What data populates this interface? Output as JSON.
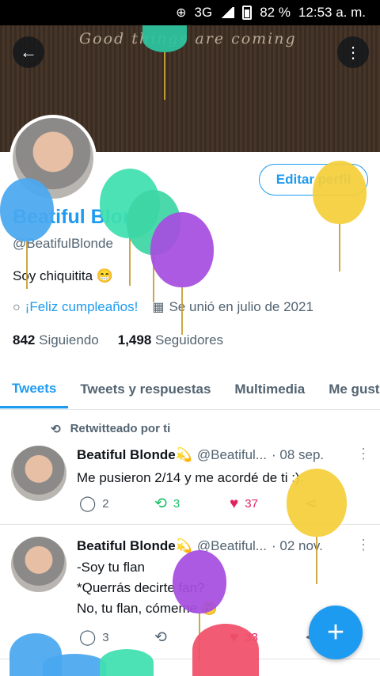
{
  "status_bar": {
    "network": "3G",
    "battery": "82 %",
    "time": "12:53 a. m."
  },
  "banner": {
    "text": "Good things are coming"
  },
  "profile": {
    "edit_label": "Editar perfil",
    "display_name": "Beatiful Blonde",
    "handle": "@BeatifulBlonde",
    "bio": "Soy chiquitita 😁",
    "birthday": "¡Feliz cumpleaños!",
    "joined": "Se unió en julio de 2021",
    "following_count": "842",
    "following_label": "Siguiendo",
    "followers_count": "1,498",
    "followers_label": "Seguidores"
  },
  "tabs": [
    "Tweets",
    "Tweets y respuestas",
    "Multimedia",
    "Me gusta"
  ],
  "retweet_label": "Retwitteado por ti",
  "tweets": [
    {
      "name": "Beatiful Blonde💫",
      "handle": "@Beatiful...",
      "date": "· 08 sep.",
      "text": "Me pusieron 2/14 y me acordé de ti :).",
      "replies": "2",
      "retweets": "3",
      "likes": "37"
    },
    {
      "name": "Beatiful Blonde💫",
      "handle": "@Beatiful...",
      "date": "· 02 nov.",
      "lines": [
        "-Soy tu flan",
        "*Querrás decirte fan?",
        "No, tu flan, cómeme 🙃"
      ],
      "replies": "3",
      "retweets": "",
      "likes": "33"
    }
  ],
  "colors": {
    "accent": "#1d9bf0",
    "like": "#e0245e",
    "retweet": "#17bf63"
  },
  "icons": [
    "back-arrow-icon",
    "more-vert-icon",
    "balloon-icon",
    "calendar-icon",
    "retweet-icon",
    "reply-icon",
    "heart-icon",
    "share-icon",
    "plus-icon"
  ]
}
